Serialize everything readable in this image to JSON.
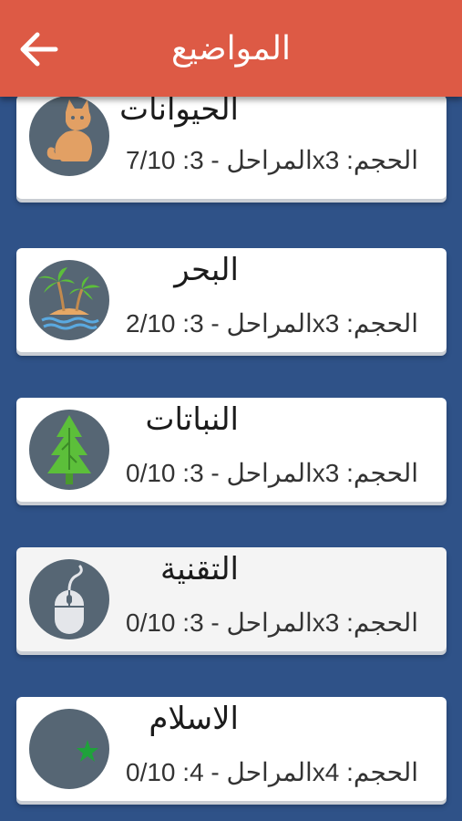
{
  "appbar": {
    "title": "المواضيع",
    "back_icon": "arrow-left-icon"
  },
  "topics": [
    {
      "title": "الحيوانات",
      "meta": "7/10 :المراحل - 3x3 :الحجم",
      "icon": "cat-icon"
    },
    {
      "title": "البحر",
      "meta": "2/10 :المراحل - 3x3 :الحجم",
      "icon": "palm-island-icon"
    },
    {
      "title": "النباتات",
      "meta": "0/10 :المراحل - 3x3 :الحجم",
      "icon": "tree-icon"
    },
    {
      "title": "التقنية",
      "meta": "0/10 :المراحل - 3x3 :الحجم",
      "icon": "mouse-icon"
    },
    {
      "title": "الاسلام",
      "meta": "0/10 :المراحل - 4x4 :الحجم",
      "icon": "crescent-star-icon"
    }
  ],
  "colors": {
    "appbar": "#dd5a45",
    "background": "#2f5288",
    "card": "#ffffff",
    "icon_circle": "#566674"
  }
}
